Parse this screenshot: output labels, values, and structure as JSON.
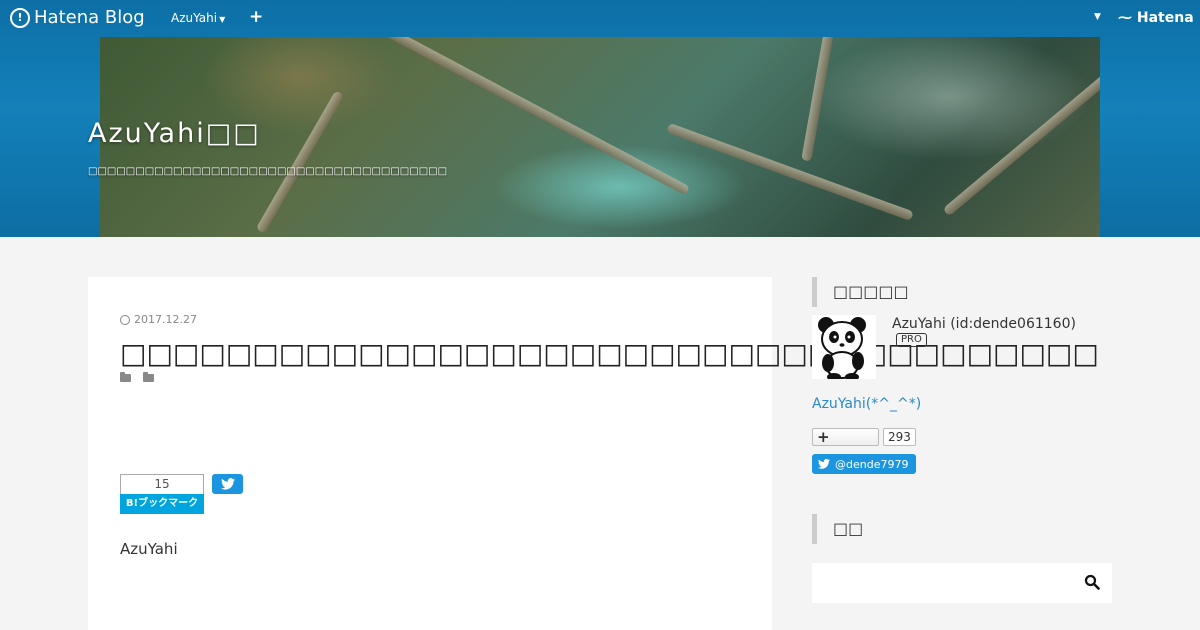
{
  "globalbar": {
    "logo_text": "Hatena Blog",
    "user_menu": "AzuYahi",
    "add_symbol": "+",
    "hatena_brand": "Hatena"
  },
  "header": {
    "blog_title": "AzuYahi□□",
    "blog_description": "□□□□□□□□□□□□□□□□□□□□□□□□□□□□□□□□□□□□□□"
  },
  "article": {
    "date": "2017.12.27",
    "title": "□□□□□□□□□□□□□□□□□□□□□□□□□□□□□□□□□□□□□",
    "bookmark_count": "15",
    "bookmark_label": "B!ブックマーク",
    "author": "AzuYahi"
  },
  "sidebar": {
    "profile_heading": "□□□□□",
    "profile_name": "AzuYahi (id:dende061160)",
    "pro_badge": "PRO",
    "profile_link": "AzuYahi(*^_^*)",
    "follow_symbol": "+",
    "follower_count": "293",
    "twitter_handle": "@dende7979",
    "search_heading": "□□",
    "search_placeholder": ""
  },
  "icons": {
    "clock": "clock-icon",
    "folder": "folder-icon",
    "twitter": "twitter-icon",
    "search": "search-icon"
  },
  "colors": {
    "header_blue": "#1380b9",
    "link_blue": "#2a8ac4",
    "bookmark_blue": "#00a4de",
    "twitter_blue": "#1b95e0"
  }
}
